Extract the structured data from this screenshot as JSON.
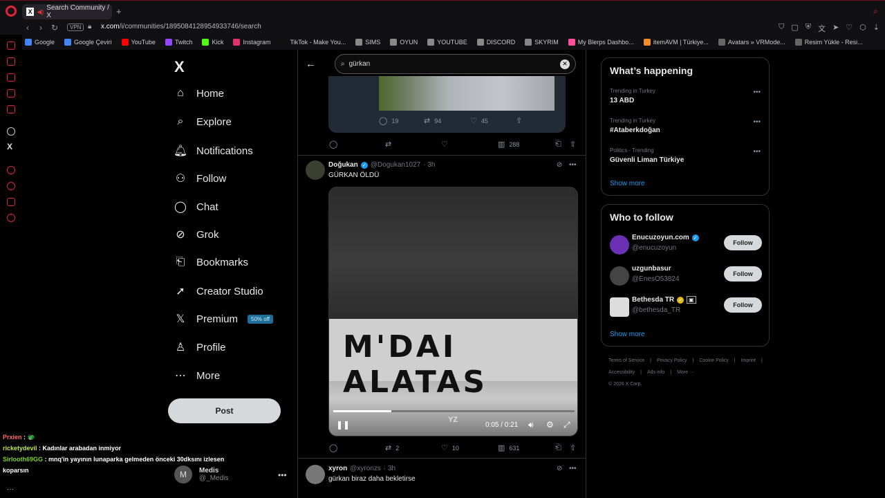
{
  "browser": {
    "tab_title": "Search Community / X",
    "url_host": "x.com",
    "url_path": "/i/communities/1895084128954933746/search",
    "vpn": "VPN",
    "bookmarks": [
      {
        "label": "Google",
        "color": "#4285f4"
      },
      {
        "label": "Google Çeviri",
        "color": "#4285f4"
      },
      {
        "label": "YouTube",
        "color": "#ff0000"
      },
      {
        "label": "Twitch",
        "color": "#9146ff"
      },
      {
        "label": "Kick",
        "color": "#53fc18"
      },
      {
        "label": "Instagram",
        "color": "#e1306c"
      },
      {
        "label": "TikTok - Make You...",
        "color": "#111111"
      },
      {
        "label": "SIMS",
        "color": "#888888"
      },
      {
        "label": "OYUN",
        "color": "#888888"
      },
      {
        "label": "YOUTUBE",
        "color": "#888888"
      },
      {
        "label": "DISCORD",
        "color": "#888888"
      },
      {
        "label": "SKYRIM",
        "color": "#888888"
      },
      {
        "label": "My Blerps Dashbo...",
        "color": "#ff4f9a"
      },
      {
        "label": "itemAVM | Türkiye...",
        "color": "#f28c28"
      },
      {
        "label": "Avatars » VRMode...",
        "color": "#666666"
      },
      {
        "label": "Resim Yükle - Resi...",
        "color": "#666666"
      }
    ]
  },
  "nav": {
    "logo": "X",
    "items": [
      {
        "label": "Home",
        "icon": "⌂"
      },
      {
        "label": "Explore",
        "icon": "⌕"
      },
      {
        "label": "Notifications",
        "icon": "🔔︎"
      },
      {
        "label": "Follow",
        "icon": "⚇"
      },
      {
        "label": "Chat",
        "icon": "◯"
      },
      {
        "label": "Grok",
        "icon": "⊘"
      },
      {
        "label": "Bookmarks",
        "icon": "⎗"
      },
      {
        "label": "Creator Studio",
        "icon": "➚"
      },
      {
        "label": "Premium",
        "icon": "𝕏"
      },
      {
        "label": "Profile",
        "icon": "♙"
      },
      {
        "label": "More",
        "icon": "⋯"
      }
    ],
    "premium_badge": "50% off",
    "post_label": "Post",
    "account": {
      "name": "Medis",
      "handle": "@_Medis",
      "initial": "M"
    }
  },
  "search": {
    "query": "gürkan"
  },
  "feed": {
    "quoted_stats": {
      "replies": "19",
      "reposts": "94",
      "likes": "45"
    },
    "prev_actions": {
      "views": "288"
    },
    "tweets": [
      {
        "name": "Doğukan",
        "handle": "@Dogukan1027",
        "time": "· 3h",
        "text": "GÜRKAN ÖLDÜ",
        "video": {
          "time": "0:05 / 0:21",
          "progress": 0.24,
          "watermark": "YZ",
          "banner": "M'DAI    ALATAS"
        },
        "stats": {
          "reposts": "2",
          "likes": "10",
          "views": "631"
        }
      },
      {
        "name": "xyron",
        "handle": "@xyronzs",
        "time": "· 3h",
        "text": "gürkan biraz daha bekletirse"
      }
    ]
  },
  "sidebar": {
    "happening_title": "What’s happening",
    "trends": [
      {
        "meta": "Trending in Turkey",
        "title": "13 ABD"
      },
      {
        "meta": "Trending in Turkey",
        "title": "#Ataberkdoğan"
      },
      {
        "meta": "Politics · Trending",
        "title": "Güvenli Liman Türkiye"
      }
    ],
    "show_more": "Show more",
    "who_title": "Who to follow",
    "who": [
      {
        "name": "Enucuzoyun.com",
        "handle": "@enucuzoyun",
        "verified": "blue",
        "avatar_color": "#6b2fb3"
      },
      {
        "name": "uzgunbasur",
        "handle": "@EnesO53824",
        "verified": "",
        "avatar_color": "#444444"
      },
      {
        "name": "Bethesda TR",
        "handle": "@bethesda_TR",
        "verified": "gold",
        "avatar_color": "#dddddd"
      }
    ],
    "follow_label": "Follow",
    "footer": [
      "Terms of Service",
      "|",
      "Privacy Policy",
      "|",
      "Cookie Policy",
      "|",
      "Imprint",
      "|",
      "Accessibility",
      "|",
      "Ads info",
      "|",
      "More ···",
      "© 2026 X Corp."
    ]
  },
  "chat_overlay": [
    {
      "user": "Prxien",
      "msg": "🐲"
    },
    {
      "user": "ricketydevil",
      "msg": "Kadınlar arabadan inmiyor"
    },
    {
      "user": "Sirlooth69GG",
      "msg": "mnq'in yayının lunaparka gelmeden önceki 30dksını izlesen koparsın"
    }
  ]
}
